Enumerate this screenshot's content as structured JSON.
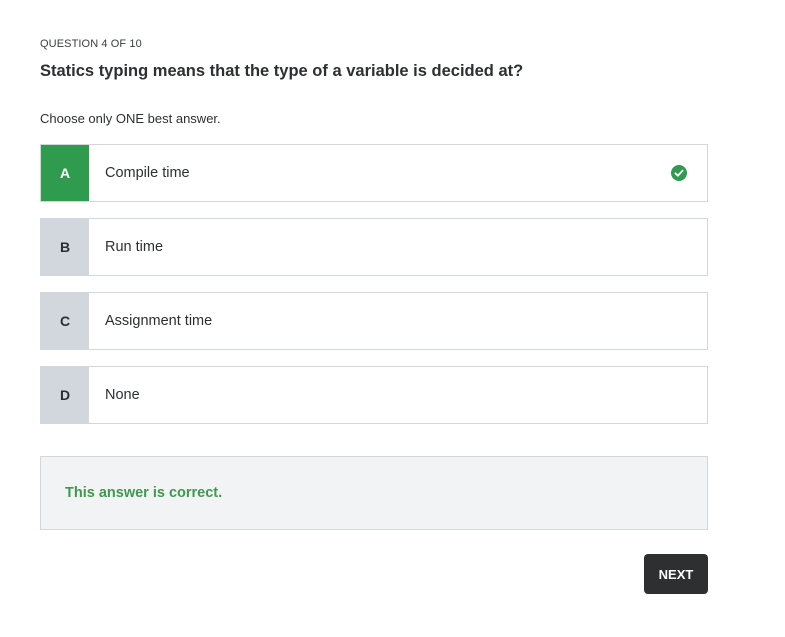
{
  "question": {
    "counter": "QUESTION 4 OF 10",
    "prompt": "Statics typing means that the type of a variable is decided at?",
    "instruction": "Choose only ONE best answer."
  },
  "options": [
    {
      "letter": "A",
      "text": "Compile time",
      "selected": true,
      "status_icon": "check-circle-icon"
    },
    {
      "letter": "B",
      "text": "Run time",
      "selected": false
    },
    {
      "letter": "C",
      "text": "Assignment time",
      "selected": false
    },
    {
      "letter": "D",
      "text": "None",
      "selected": false
    }
  ],
  "feedback": {
    "message": "This answer is correct."
  },
  "actions": {
    "next_label": "NEXT"
  },
  "colors": {
    "correct_green": "#2e9b4f",
    "feedback_text": "#3d9a4c",
    "letter_bg": "#d1d7dc",
    "button_bg": "#2d2f31"
  }
}
